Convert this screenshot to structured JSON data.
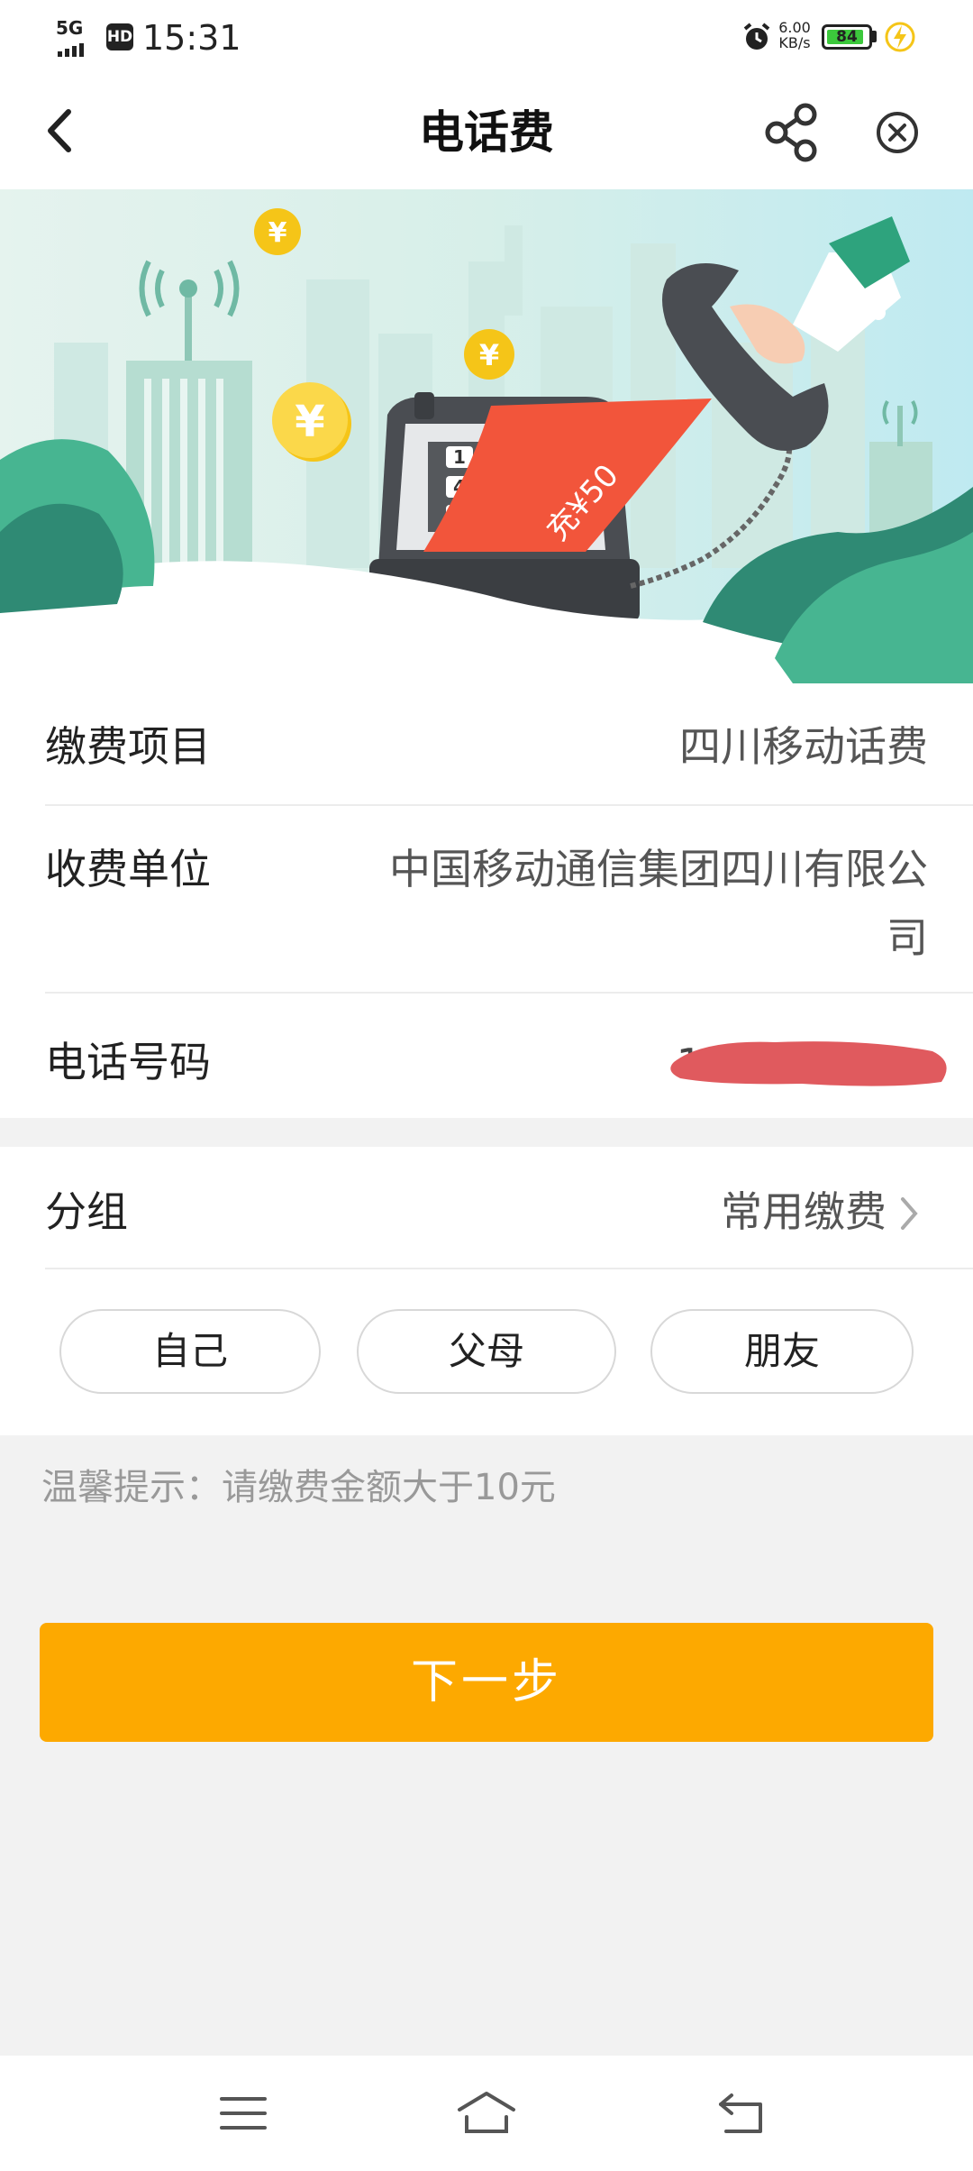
{
  "status_bar": {
    "network": "5G",
    "hd": "HD",
    "time": "15:31",
    "speed_value": "6.00",
    "speed_unit": "KB/s",
    "battery": "84"
  },
  "header": {
    "title": "电话费",
    "back_icon": "chevron-left-icon",
    "share_icon": "share-icon",
    "close_icon": "close-circle-icon"
  },
  "banner": {
    "card_text": "充¥50"
  },
  "form": {
    "item_label": "缴费项目",
    "item_value": "四川移动话费",
    "payee_label": "收费单位",
    "payee_value_line1": "中国移动通信集团四川有限公",
    "payee_value_line2": "司",
    "phone_label": "电话号码",
    "phone_value_partial": "1"
  },
  "group": {
    "label": "分组",
    "value": "常用缴费",
    "chips": [
      "自己",
      "父母",
      "朋友"
    ]
  },
  "hint": "温馨提示：请缴费金额大于10元",
  "next_button": "下一步",
  "colors": {
    "accent": "#fda900",
    "redact": "#e05a5e"
  }
}
